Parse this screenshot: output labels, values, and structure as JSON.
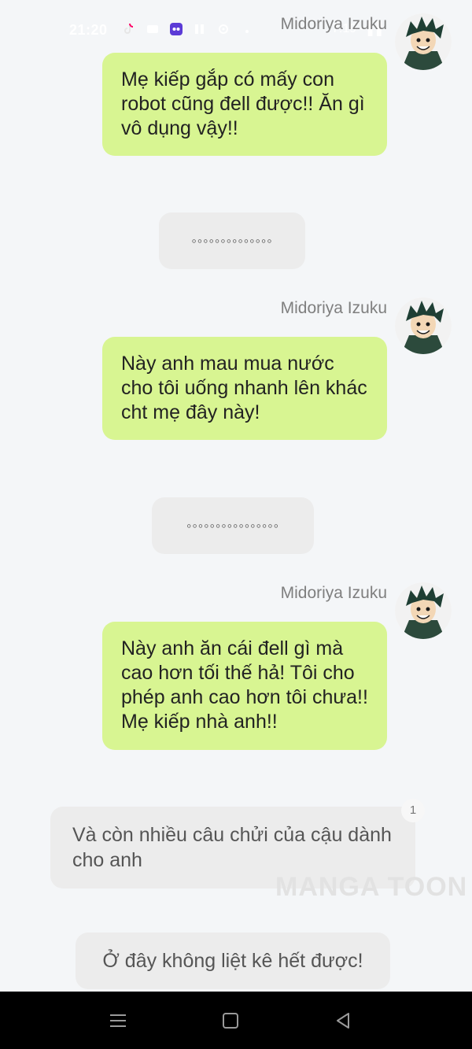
{
  "status_bar": {
    "time": "21:20",
    "right_text": "7:19 ◦ ▌▌"
  },
  "icons": {
    "tiktok": "tiktok-icon",
    "media": "media-icon",
    "app": "app-icon",
    "pause": "pause-icon",
    "settings": "settings-icon",
    "dot": "dot-icon"
  },
  "messages": [
    {
      "sender": "Midoriya Izuku",
      "text": "Mẹ kiếp gắp có mấy con robot cũng đell được!! Ăn gì vô dụng vậy!!"
    },
    {
      "narration": "◦◦◦◦◦◦◦◦◦◦◦◦◦◦"
    },
    {
      "sender": "Midoriya Izuku",
      "text": "Này anh mau mua nước cho tôi uống nhanh lên khác cht mẹ đây này!"
    },
    {
      "narration": "◦◦◦◦◦◦◦◦◦◦◦◦◦◦◦◦"
    },
    {
      "sender": "Midoriya Izuku",
      "text": "Này anh ăn cái đell gì mà cao hơn tối thế hả! Tôi cho phép anh cao hơn tôi chưa!! Mẹ kiếp nhà anh!!"
    },
    {
      "text": "Và còn nhiều câu chửi của cậu dành cho anh",
      "badge": "1"
    },
    {
      "narration": "Ở đây không liệt kê hết được!"
    }
  ],
  "watermark": "MANGA TOON",
  "colors": {
    "background": "#f4f6f8",
    "bubble_green": "#d8f592",
    "bubble_gray": "#ececec",
    "nav_bar": "#000000"
  }
}
